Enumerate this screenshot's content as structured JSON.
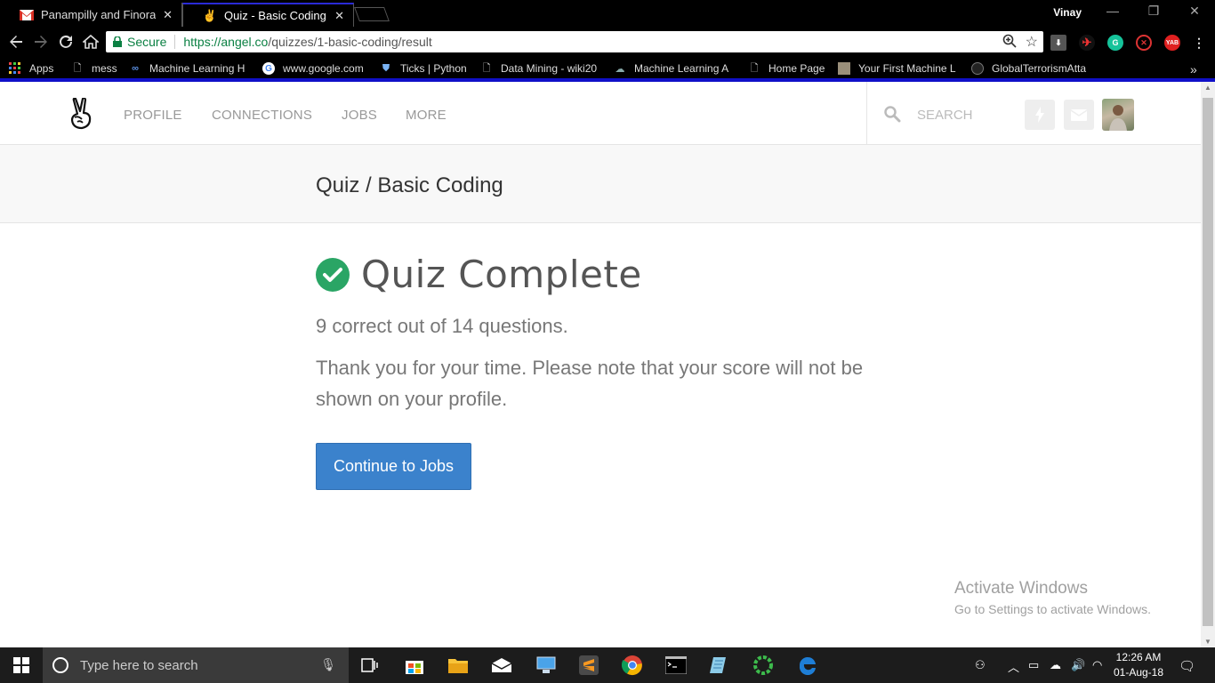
{
  "browser": {
    "tabs": [
      {
        "title": "Panampilly and Finoramic",
        "active": false
      },
      {
        "title": "Quiz - Basic Coding - AngelList",
        "active": true
      }
    ],
    "profile_name": "Vinay",
    "secure_label": "Secure",
    "url_host": "https://angel.co",
    "url_path": "/quizzes/1-basic-coding/result",
    "bookmarks": [
      {
        "label": "Apps",
        "icon": "apps-grid-icon"
      },
      {
        "label": "mess",
        "icon": "page-icon"
      },
      {
        "label": "Machine Learning H",
        "icon": "coursera-icon"
      },
      {
        "label": "www.google.com",
        "icon": "google-icon"
      },
      {
        "label": "Ticks | Python",
        "icon": "shield-icon"
      },
      {
        "label": "Data Mining - wiki20",
        "icon": "page-icon"
      },
      {
        "label": "Machine Learning A",
        "icon": "brain-icon"
      },
      {
        "label": "Home Page",
        "icon": "page-icon"
      },
      {
        "label": "Your First Machine L",
        "icon": "thumbnail-icon"
      },
      {
        "label": "GlobalTerrorismAtta",
        "icon": "github-icon"
      }
    ],
    "more_bookmarks": "»"
  },
  "site": {
    "nav": [
      "PROFILE",
      "CONNECTIONS",
      "JOBS",
      "MORE"
    ],
    "search_placeholder": "SEARCH"
  },
  "quiz": {
    "breadcrumb": "Quiz / Basic Coding",
    "status": "Quiz Complete",
    "score_text": "9 correct out of 14 questions.",
    "thanks_text": "Thank you for your time. Please note that your score will not be shown on your profile.",
    "continue_label": "Continue to Jobs"
  },
  "watermark": {
    "title": "Activate Windows",
    "subtitle": "Go to Settings to activate Windows."
  },
  "taskbar": {
    "search_placeholder": "Type here to search",
    "time": "12:26 AM",
    "date": "01-Aug-18"
  },
  "colors": {
    "accent_button": "#3b82cc",
    "success": "#2aa565",
    "secure": "#0b8043"
  }
}
